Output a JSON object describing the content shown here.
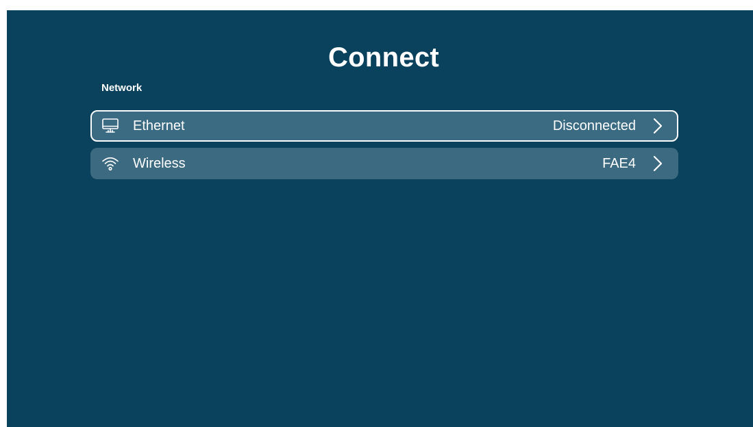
{
  "page": {
    "title": "Connect",
    "section_label": "Network"
  },
  "colors": {
    "background": "#0a425e",
    "row": "#3c6a81",
    "text": "#ffffff"
  },
  "network_items": [
    {
      "label": "Ethernet",
      "value": "Disconnected",
      "icon": "monitor-icon",
      "focused": true
    },
    {
      "label": "Wireless",
      "value": "FAE4",
      "icon": "wifi-icon",
      "focused": false
    }
  ]
}
